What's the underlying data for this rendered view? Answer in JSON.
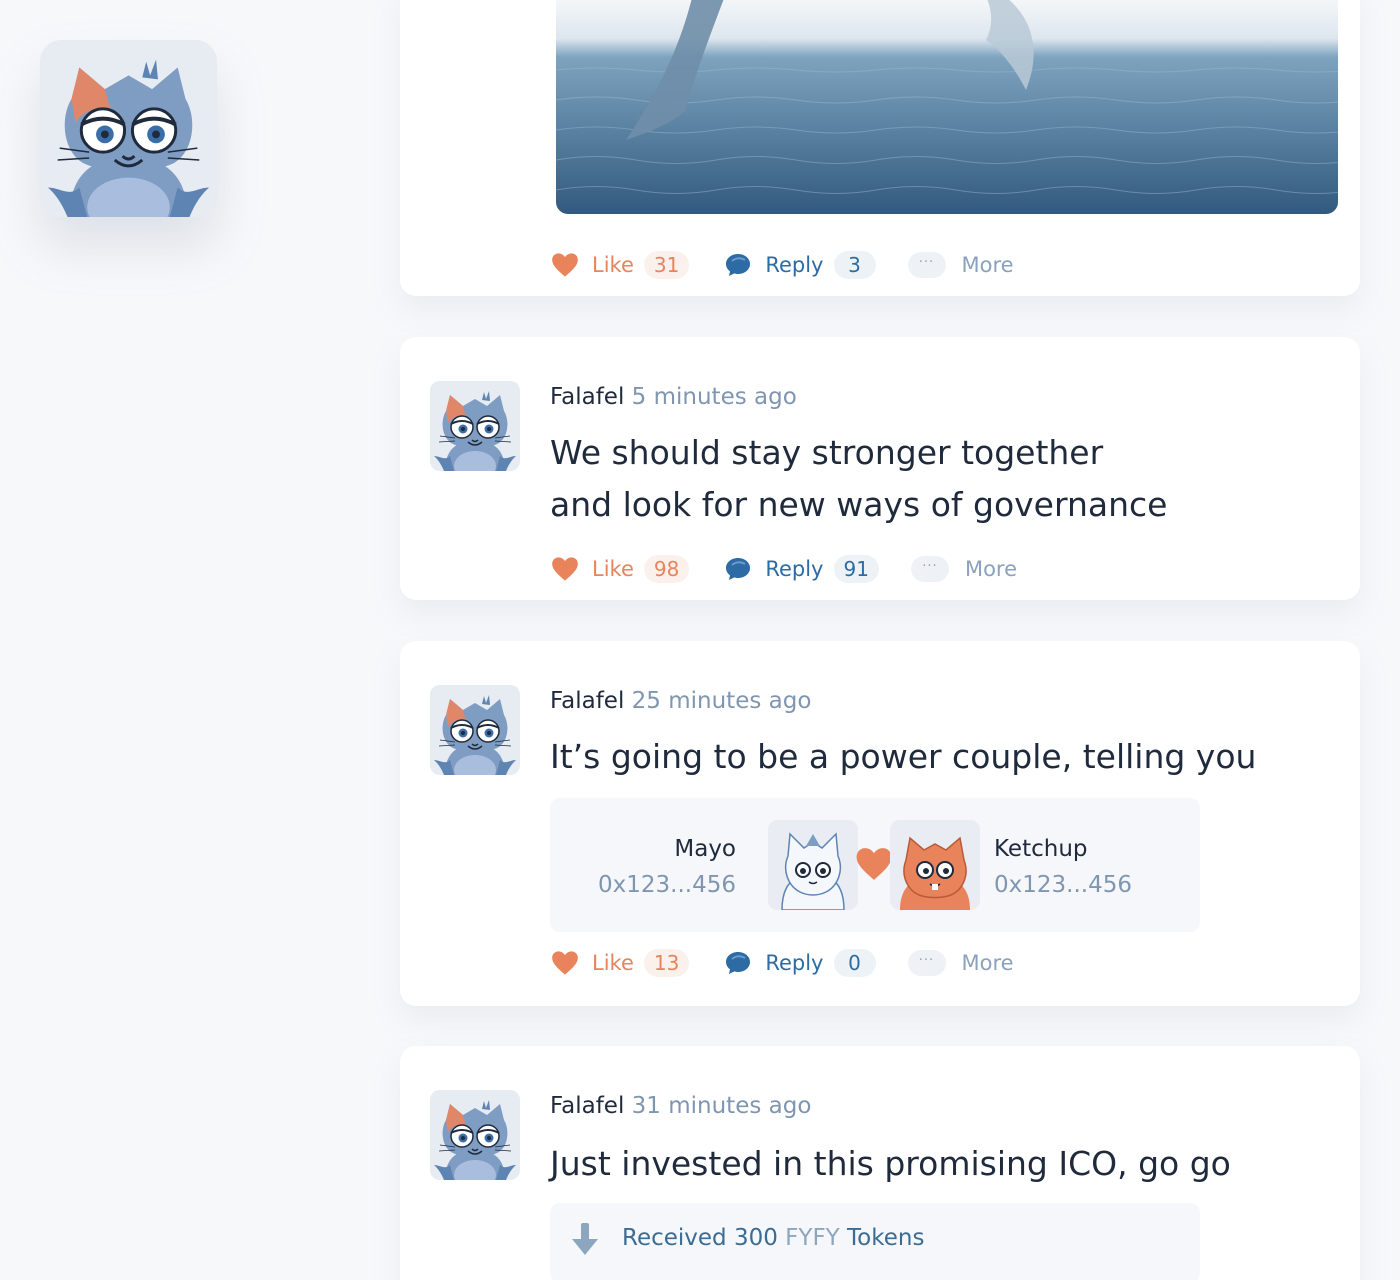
{
  "posts": [
    {
      "likes": "31",
      "replies": "3"
    },
    {
      "author": "Falafel",
      "time": "5 minutes ago",
      "text_line1": "We should stay stronger together",
      "text_line2": "and look for new ways of governance",
      "likes": "98",
      "replies": "91"
    },
    {
      "author": "Falafel",
      "time": "25 minutes ago",
      "text_line1": "It’s going to be a power couple, telling you",
      "likes": "13",
      "replies": "0",
      "couple": {
        "left_name": "Mayo",
        "left_address": "0x123...456",
        "right_name": "Ketchup",
        "right_address": "0x123...456"
      }
    },
    {
      "author": "Falafel",
      "time": "31 minutes ago",
      "text_line1": "Just invested in this promising ICO, go go",
      "tokens": {
        "prefix": "Received 300 ",
        "symbol": "FYFY",
        "suffix": " Tokens"
      }
    }
  ],
  "labels": {
    "like": "Like",
    "reply": "Reply",
    "more": "More",
    "dots": "···"
  },
  "colors": {
    "like": "#e8835b",
    "reply": "#2c6ba3",
    "muted": "#8096b0"
  },
  "icons": [
    "heart-icon",
    "speech-bubble-icon",
    "ellipsis-icon",
    "download-arrow-icon"
  ]
}
